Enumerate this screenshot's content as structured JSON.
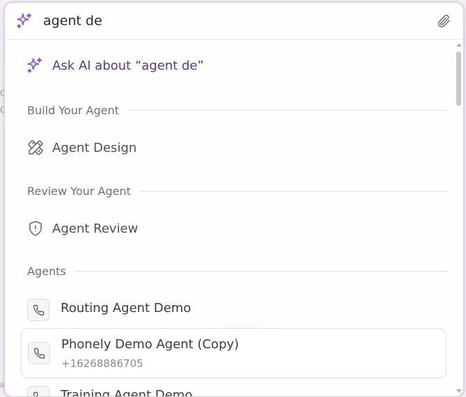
{
  "search": {
    "value": "agent de",
    "placeholder": ""
  },
  "ask_ai": {
    "label": "Ask AI about “agent de”"
  },
  "sections": {
    "build": {
      "title": "Build Your Agent",
      "item_label": "Agent Design"
    },
    "review": {
      "title": "Review Your Agent",
      "item_label": "Agent Review"
    },
    "agents": {
      "title": "Agents",
      "items": [
        {
          "name": "Routing Agent Demo",
          "phone": ""
        },
        {
          "name": "Phonely Demo Agent (Copy)",
          "phone": "+16268886705"
        },
        {
          "name": "Training Agent Demo",
          "phone": ""
        }
      ]
    }
  },
  "background": {
    "left_fragments": [
      "G",
      "C",
      "a"
    ]
  },
  "icons": {
    "sparkle": "sparkles-icon",
    "attach": "paperclip-icon",
    "design": "pencil-ruler-icon",
    "review": "shield-alert-icon",
    "phone": "phone-icon"
  },
  "colors": {
    "accent": "#5a3399",
    "sparkle": "#8a5cc7",
    "border": "#d9c9ec"
  }
}
